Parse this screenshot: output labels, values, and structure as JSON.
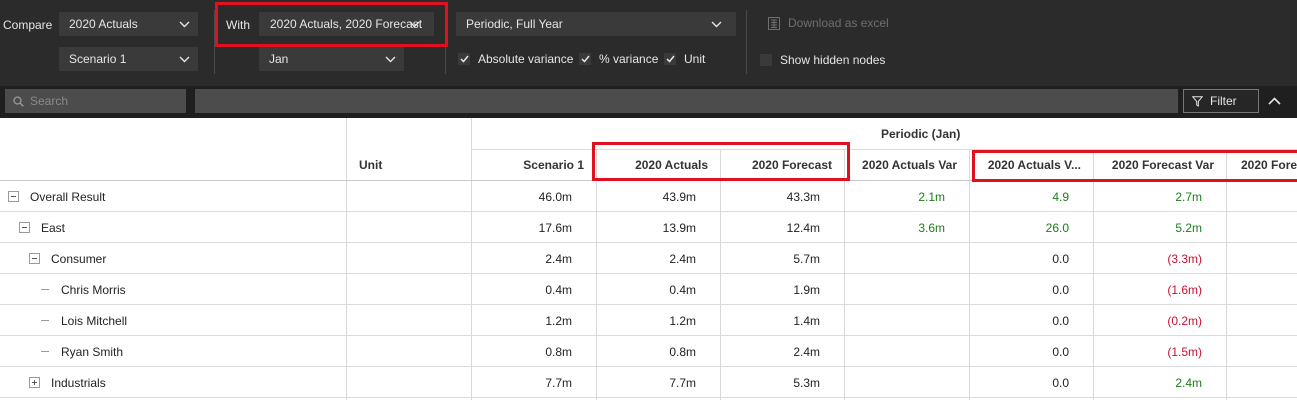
{
  "toolbar": {
    "compare_label": "Compare",
    "compare_value": "2020 Actuals",
    "scenario_value": "Scenario 1",
    "with_label": "With",
    "with_value": "2020 Actuals, 2020 Forecast",
    "period_value": "Jan",
    "periodic_value": "Periodic, Full Year",
    "checkboxes": [
      {
        "label": "Absolute variance",
        "checked": true
      },
      {
        "label": "% variance",
        "checked": true
      },
      {
        "label": "Unit",
        "checked": true
      }
    ],
    "download_label": "Download as excel",
    "show_hidden_label": "Show hidden nodes",
    "show_hidden_checked": false
  },
  "search": {
    "placeholder": "Search",
    "filter_label": "Filter"
  },
  "colors": {
    "highlight": "#e0101e",
    "positive": "#1a7f1a",
    "negative": "#c8102e",
    "toolbar_bg": "#2b2b2b"
  },
  "grid": {
    "group_header": "Periodic (Jan)",
    "unit_header": "Unit",
    "columns": [
      "Scenario 1",
      "2020 Actuals",
      "2020 Forecast",
      "2020 Actuals Var",
      "2020 Actuals V...",
      "2020 Forecast Var",
      "2020 Fore"
    ],
    "rows": [
      {
        "label": "Overall Result",
        "toggle": "minus",
        "level": 0,
        "values": [
          "46.0m",
          "43.9m",
          "43.3m",
          "2.1m",
          "4.9",
          "2.7m",
          ""
        ]
      },
      {
        "label": "East",
        "toggle": "minus",
        "level": 1,
        "values": [
          "17.6m",
          "13.9m",
          "12.4m",
          "3.6m",
          "26.0",
          "5.2m",
          ""
        ]
      },
      {
        "label": "Consumer",
        "toggle": "minus",
        "level": 2,
        "values": [
          "2.4m",
          "2.4m",
          "5.7m",
          "",
          "0.0",
          "(3.3m)",
          ""
        ]
      },
      {
        "label": "Chris Morris",
        "toggle": "leaf",
        "level": 3,
        "values": [
          "0.4m",
          "0.4m",
          "1.9m",
          "",
          "0.0",
          "(1.6m)",
          ""
        ]
      },
      {
        "label": "Lois Mitchell",
        "toggle": "leaf",
        "level": 3,
        "values": [
          "1.2m",
          "1.2m",
          "1.4m",
          "",
          "0.0",
          "(0.2m)",
          ""
        ]
      },
      {
        "label": "Ryan Smith",
        "toggle": "leaf",
        "level": 3,
        "values": [
          "0.8m",
          "0.8m",
          "2.4m",
          "",
          "0.0",
          "(1.5m)",
          ""
        ]
      },
      {
        "label": "Industrials",
        "toggle": "plus",
        "level": 2,
        "values": [
          "7.7m",
          "7.7m",
          "5.3m",
          "",
          "0.0",
          "2.4m",
          ""
        ]
      }
    ]
  }
}
